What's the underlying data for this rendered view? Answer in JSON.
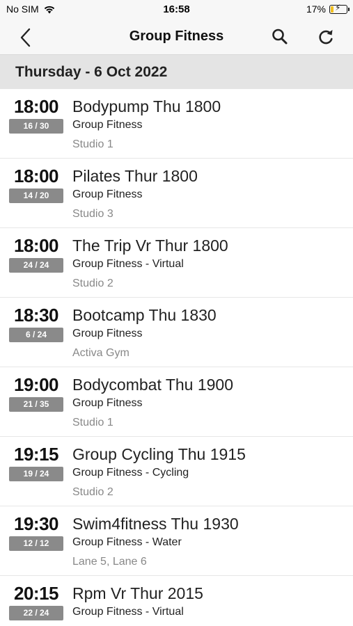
{
  "status_bar": {
    "carrier": "No SIM",
    "time": "16:58",
    "battery": "17%"
  },
  "nav": {
    "title": "Group Fitness"
  },
  "date_header": "Thursday - 6 Oct 2022",
  "classes": [
    {
      "time": "18:00",
      "capacity": "16 / 30",
      "name": "Bodypump Thu 1800",
      "category": "Group Fitness",
      "location": "Studio 1"
    },
    {
      "time": "18:00",
      "capacity": "14 / 20",
      "name": "Pilates Thur 1800",
      "category": "Group Fitness",
      "location": "Studio 3"
    },
    {
      "time": "18:00",
      "capacity": "24 / 24",
      "name": "The Trip Vr Thur 1800",
      "category": "Group Fitness - Virtual",
      "location": "Studio 2"
    },
    {
      "time": "18:30",
      "capacity": "6 / 24",
      "name": "Bootcamp Thu 1830",
      "category": "Group Fitness",
      "location": "Activa Gym"
    },
    {
      "time": "19:00",
      "capacity": "21 / 35",
      "name": "Bodycombat Thu 1900",
      "category": "Group Fitness",
      "location": "Studio 1"
    },
    {
      "time": "19:15",
      "capacity": "19 / 24",
      "name": "Group Cycling Thu 1915",
      "category": "Group Fitness - Cycling",
      "location": "Studio 2"
    },
    {
      "time": "19:30",
      "capacity": "12 / 12",
      "name": "Swim4fitness Thu 1930",
      "category": "Group Fitness - Water",
      "location": "Lane 5, Lane 6"
    },
    {
      "time": "20:15",
      "capacity": "22 / 24",
      "name": "Rpm Vr Thur 2015",
      "category": "Group Fitness - Virtual",
      "location": ""
    }
  ]
}
